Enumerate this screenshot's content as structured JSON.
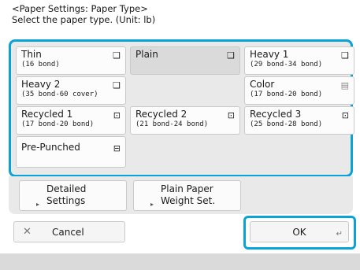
{
  "header": {
    "title": "<Paper Settings: Paper Type>",
    "instruction": "Select the paper type. (Unit: lb)"
  },
  "paper_types": [
    {
      "name": "Thin",
      "sub": "(16 bond)",
      "icon": "paper-thin-icon",
      "selected": false
    },
    {
      "name": "Plain",
      "sub": "",
      "icon": "paper-plain-icon",
      "selected": true
    },
    {
      "name": "Heavy 1",
      "sub": "(29 bond-34 bond)",
      "icon": "paper-heavy-icon",
      "selected": false
    },
    {
      "name": "Heavy 2",
      "sub": "(35 bond-60 cover)",
      "icon": "paper-heavy-icon",
      "selected": false
    },
    {
      "name": "Color",
      "sub": "(17 bond-20 bond)",
      "icon": "paper-color-icon",
      "selected": false
    },
    {
      "name": "Recycled 1",
      "sub": "(17 bond-20 bond)",
      "icon": "paper-recycled-icon",
      "selected": false
    },
    {
      "name": "Recycled 2",
      "sub": "(21 bond-24 bond)",
      "icon": "paper-recycled-icon",
      "selected": false
    },
    {
      "name": "Recycled 3",
      "sub": "(25 bond-28 bond)",
      "icon": "paper-recycled-icon",
      "selected": false
    },
    {
      "name": "Pre-Punched",
      "sub": "",
      "icon": "paper-prepunched-icon",
      "selected": false
    }
  ],
  "options": {
    "detailed_settings": "Detailed\nSettings",
    "plain_paper_weight": "Plain Paper\nWeight Set."
  },
  "buttons": {
    "cancel": "Cancel",
    "ok": "OK"
  },
  "colors": {
    "focus_outline": "#0aa3d8",
    "panel_bg": "#e9e9e9",
    "selected_tile": "#dadada"
  }
}
